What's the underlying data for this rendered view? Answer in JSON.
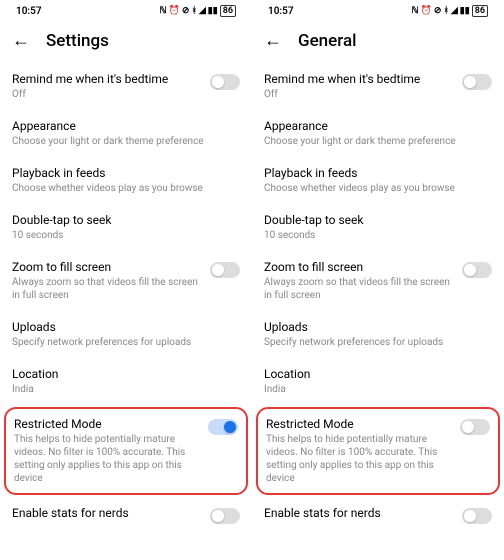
{
  "left": {
    "time": "10:57",
    "battery": "86",
    "title": "Settings",
    "bedtime_title": "Remind me when it's bedtime",
    "bedtime_sub": "Off",
    "appearance_title": "Appearance",
    "appearance_sub": "Choose your light or dark theme preference",
    "playback_title": "Playback in feeds",
    "playback_sub": "Choose whether videos play as you browse",
    "doubletap_title": "Double-tap to seek",
    "doubletap_sub": "10 seconds",
    "zoom_title": "Zoom to fill screen",
    "zoom_sub": "Always zoom so that videos fill the screen in full screen",
    "uploads_title": "Uploads",
    "uploads_sub": "Specify network preferences for uploads",
    "location_title": "Location",
    "location_sub": "India",
    "restricted_title": "Restricted Mode",
    "restricted_sub": "This helps to hide potentially mature videos. No filter is 100% accurate. This setting only applies to this app on this device",
    "stats_title": "Enable stats for nerds"
  },
  "right": {
    "time": "10:57",
    "battery": "86",
    "title": "General",
    "bedtime_title": "Remind me when it's bedtime",
    "bedtime_sub": "Off",
    "appearance_title": "Appearance",
    "appearance_sub": "Choose your light or dark theme preference",
    "playback_title": "Playback in feeds",
    "playback_sub": "Choose whether videos play as you browse",
    "doubletap_title": "Double-tap to seek",
    "doubletap_sub": "10 seconds",
    "zoom_title": "Zoom to fill screen",
    "zoom_sub": "Always zoom so that videos fill the screen in full screen",
    "uploads_title": "Uploads",
    "uploads_sub": "Specify network preferences for uploads",
    "location_title": "Location",
    "location_sub": "India",
    "restricted_title": "Restricted Mode",
    "restricted_sub": "This helps to hide potentially mature videos. No filter is 100% accurate. This setting only applies to this app on this device",
    "stats_title": "Enable stats for nerds"
  }
}
